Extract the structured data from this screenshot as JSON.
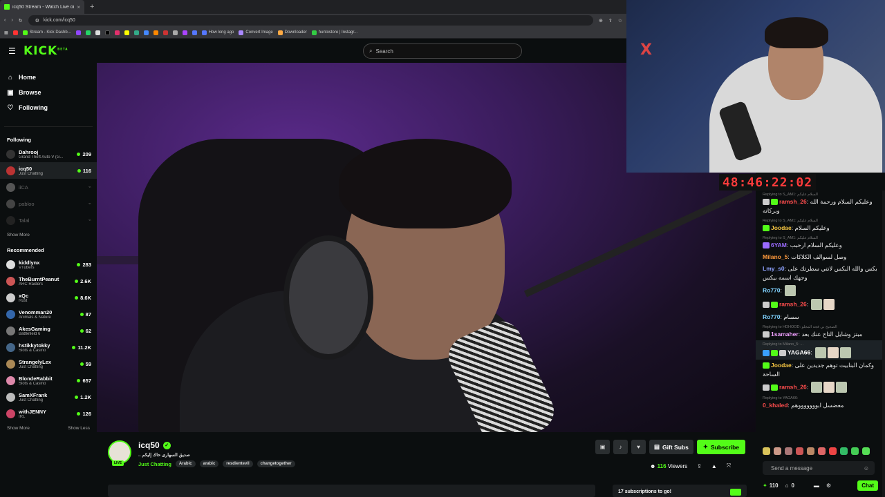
{
  "browser": {
    "tab_title": "icq50 Stream - Watch Live on K",
    "tab_close": "×",
    "new_tab": "+",
    "url": "kick.com/icq50",
    "bookmarks": [
      "Stream - Kick Dashb...",
      "How long ago",
      "Convert Image",
      "Downloader",
      "huntostore | Instagr..."
    ]
  },
  "header": {
    "logo": "KICK",
    "logo_sup": "BETA",
    "search_placeholder": "Search"
  },
  "nav": [
    {
      "label": "Home",
      "icon": "⌂"
    },
    {
      "label": "Browse",
      "icon": "▣"
    },
    {
      "label": "Following",
      "icon": "♡"
    }
  ],
  "following": {
    "heading": "Following",
    "channels": [
      {
        "name": "Dahrooj",
        "category": "Grand Theft Auto V (G...",
        "viewers": "209",
        "live": true,
        "avatar_color": "#333"
      },
      {
        "name": "icq50",
        "category": "Just Chatting",
        "viewers": "116",
        "live": true,
        "selected": true,
        "avatar_color": "#b33"
      },
      {
        "name": "iiCA",
        "category": "",
        "viewers": "",
        "live": false,
        "avatar_color": "#555"
      },
      {
        "name": "pabloo",
        "category": "",
        "viewers": "",
        "live": false,
        "avatar_color": "#444"
      },
      {
        "name": "Talal",
        "category": "",
        "viewers": "",
        "live": false,
        "avatar_color": "#222"
      }
    ],
    "show_more": "Show More"
  },
  "recommended": {
    "heading": "Recommended",
    "channels": [
      {
        "name": "kiddlynx",
        "category": "VTubers",
        "viewers": "283",
        "avatar_color": "#ddd"
      },
      {
        "name": "TheBurntPeanut",
        "category": "ARC Raiders",
        "viewers": "2.6K",
        "avatar_color": "#c55"
      },
      {
        "name": "xQc",
        "category": "Rust",
        "viewers": "8.6K",
        "avatar_color": "#ccc"
      },
      {
        "name": "Venomman20",
        "category": "Animals & Nature",
        "viewers": "87",
        "avatar_color": "#36a"
      },
      {
        "name": "AkesGaming",
        "category": "Battlefield 6",
        "viewers": "62",
        "avatar_color": "#777"
      },
      {
        "name": "hstikkytokky",
        "category": "Slots & Casino",
        "viewers": "11.2K",
        "avatar_color": "#468"
      },
      {
        "name": "StrangelyLex",
        "category": "Just Chatting",
        "viewers": "59",
        "avatar_color": "#a85"
      },
      {
        "name": "BlondeRabbit",
        "category": "Slots & Casino",
        "viewers": "657",
        "avatar_color": "#d8a"
      },
      {
        "name": "SamXFrank",
        "category": "Just Chatting",
        "viewers": "1.2K",
        "avatar_color": "#bbb"
      },
      {
        "name": "withJENNY",
        "category": "IRL",
        "viewers": "126",
        "avatar_color": "#c46"
      }
    ],
    "show_more": "Show More",
    "show_less": "Show Less"
  },
  "overlay": {
    "timer": "48:46:22:02"
  },
  "chat": {
    "messages": [
      {
        "reply": "Replying to S_AM1: السلام عليكم",
        "user": "ramsh_26",
        "user_color": "#ff4d4d",
        "badges": [
          "#cccccc",
          "#53fc18"
        ],
        "text": "وعليكم السلام ورحمة الله وبركاته",
        "emotes": 0
      },
      {
        "reply": "Replying to S_AM1: السلام عليكم",
        "user": "Joodae",
        "user_color": "#f5c542",
        "badges": [
          "#53fc18"
        ],
        "text": "وعليكم السلام",
        "emotes": 0
      },
      {
        "reply": "Replying to S_AM1: السلام عليكم",
        "user": "6YAM",
        "user_color": "#9b6bff",
        "badges": [
          "#9b6bff"
        ],
        "text": "وعليكم السلام ارحبب",
        "emotes": 0
      },
      {
        "reply": "",
        "user": "Milano_5",
        "user_color": "#ff9a3c",
        "badges": [],
        "text": "وصل لسوالف الكلاكات",
        "emotes": 0
      },
      {
        "reply": "",
        "user": "Lmy_s0",
        "user_color": "#8fa3ff",
        "badges": [],
        "text": "بكس والله البكس لانتي سطرتك على وجهك اسمه بيكس",
        "emotes": 0
      },
      {
        "reply": "",
        "user": "Ro770",
        "user_color": "#7fd3ff",
        "badges": [],
        "text": "",
        "emotes": 1
      },
      {
        "reply": "",
        "user": "ramsh_26",
        "user_color": "#ff4d4d",
        "badges": [
          "#cccccc",
          "#53fc18"
        ],
        "text": "",
        "emotes": 2
      },
      {
        "reply": "",
        "user": "Ro770",
        "user_color": "#7fd3ff",
        "badges": [],
        "text": "سسام",
        "emotes": 0
      },
      {
        "reply": "Replying to HDHOOD: الصحيح بي فجة المجلو",
        "user": "1samaher",
        "user_color": "#f0a0ff",
        "badges": [
          "#cccccc"
        ],
        "text": "مبتز وشايل التاج عنك بعد",
        "emotes": 0
      },
      {
        "reply": "Replying to Milano_5: ...",
        "user": "YAGA66",
        "user_color": "#ffffff",
        "badges": [
          "#3aa0ff",
          "#53fc18",
          "#cccccc"
        ],
        "text": "",
        "emotes": 3,
        "highlight": true
      },
      {
        "reply": "",
        "user": "Joodae",
        "user_color": "#f5c542",
        "badges": [
          "#53fc18"
        ],
        "text": "وكمان البنابيت توهم جديدين على الساحة",
        "emotes": 0
      },
      {
        "reply": "",
        "user": "ramsh_26",
        "user_color": "#ff4d4d",
        "badges": [
          "#cccccc",
          "#53fc18"
        ],
        "text": "",
        "emotes": 3
      },
      {
        "reply": "Replying to YAGA66:",
        "user": "0_khaled",
        "user_color": "#ff4d4d",
        "badges": [],
        "text": "معضسل ابوووووووهم",
        "emotes": 0
      }
    ],
    "input_placeholder": "Send a message",
    "points": "110",
    "gifts": "0",
    "chat_button": "Chat"
  },
  "stream": {
    "name": "icq50",
    "title": ".. صديق السهارى حاك إليكم",
    "category": "Just Chatting",
    "tags": [
      "Arabic",
      "arabic",
      "resdientevil",
      "changetogether"
    ],
    "live_label": "LIVE",
    "gift_subs": "Gift Subs",
    "subscribe": "Subscribe",
    "viewers": "116",
    "viewers_label": "Viewers",
    "sub_goal": "17 subscriptions to go!"
  }
}
